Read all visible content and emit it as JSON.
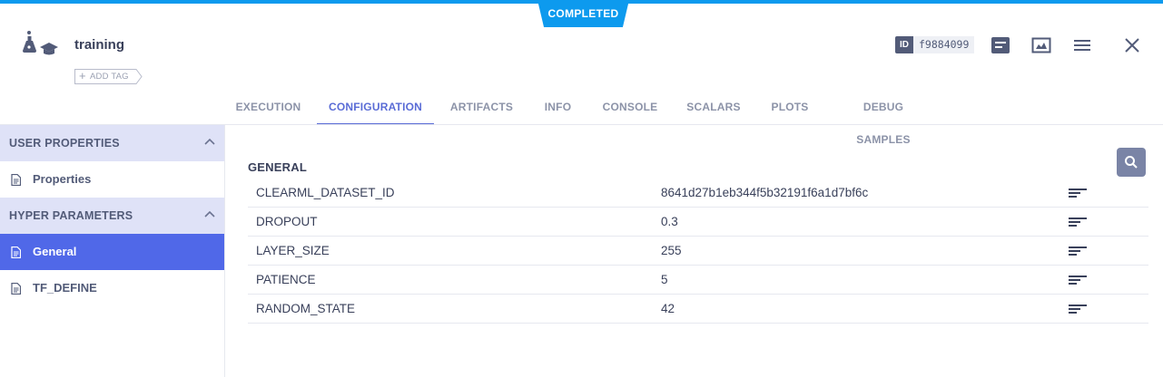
{
  "status": "COMPLETED",
  "task": {
    "title": "training",
    "add_tag_label": "ADD TAG",
    "id_badge": "ID",
    "id_value": "f9884099"
  },
  "header_icons": [
    "info-panel-icon",
    "image-chart-icon",
    "menu-icon",
    "close-icon"
  ],
  "tabs": [
    {
      "label": "EXECUTION",
      "active": false
    },
    {
      "label": "CONFIGURATION",
      "active": true
    },
    {
      "label": "ARTIFACTS",
      "active": false
    },
    {
      "label": "INFO",
      "active": false
    },
    {
      "label": "CONSOLE",
      "active": false
    },
    {
      "label": "SCALARS",
      "active": false
    },
    {
      "label": "PLOTS",
      "active": false
    },
    {
      "label": "DEBUG SAMPLES",
      "active": false
    }
  ],
  "sidebar": {
    "sections": [
      {
        "title": "USER PROPERTIES",
        "items": [
          {
            "label": "Properties",
            "active": false
          }
        ]
      },
      {
        "title": "HYPER PARAMETERS",
        "items": [
          {
            "label": "General",
            "active": true
          },
          {
            "label": "TF_DEFINE",
            "active": false
          }
        ]
      }
    ]
  },
  "main": {
    "section_title": "GENERAL",
    "params": [
      {
        "name": "CLEARML_DATASET_ID",
        "value": "8641d27b1eb344f5b32191f6a1d7bf6c"
      },
      {
        "name": "DROPOUT",
        "value": "0.3"
      },
      {
        "name": "LAYER_SIZE",
        "value": "255"
      },
      {
        "name": "PATIENCE",
        "value": "5"
      },
      {
        "name": "RANDOM_STATE",
        "value": "42"
      }
    ]
  },
  "colors": {
    "accent": "#0d9aee",
    "active_tab": "#5a6cd6",
    "active_item": "#5068e8",
    "section_bg": "#dfe2f7"
  }
}
